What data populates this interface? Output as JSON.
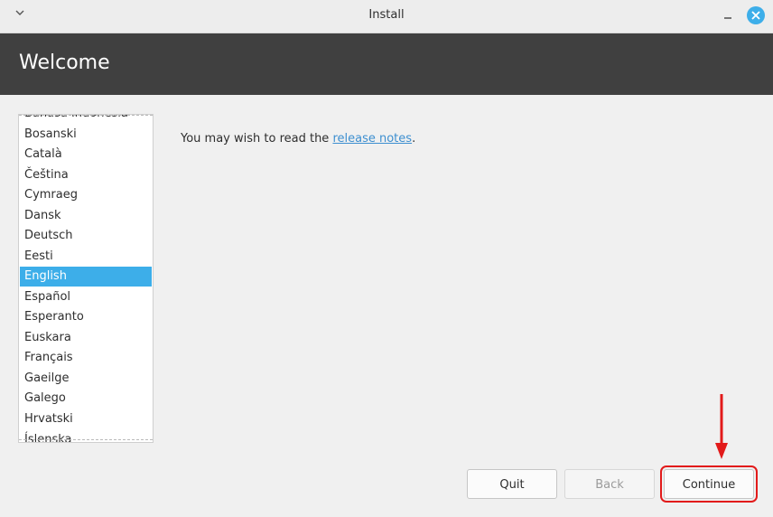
{
  "window": {
    "title": "Install",
    "menu_icon": "chevron-down-icon",
    "minimize_icon": "minimize-icon",
    "close_icon": "close-icon"
  },
  "header": {
    "title": "Welcome"
  },
  "language_list": {
    "items": [
      "Bahasa Indonesia",
      "Bosanski",
      "Català",
      "Čeština",
      "Cymraeg",
      "Dansk",
      "Deutsch",
      "Eesti",
      "English",
      "Español",
      "Esperanto",
      "Euskara",
      "Français",
      "Gaeilge",
      "Galego",
      "Hrvatski",
      "Íslenska"
    ],
    "selected": "English"
  },
  "release_notes": {
    "prefix": "You may wish to read the ",
    "link": "release notes",
    "suffix": "."
  },
  "buttons": {
    "quit": "Quit",
    "back": "Back",
    "continue": "Continue"
  },
  "colors": {
    "accent": "#3daee9",
    "header_bg": "#404040",
    "highlight": "#e21a1a"
  }
}
